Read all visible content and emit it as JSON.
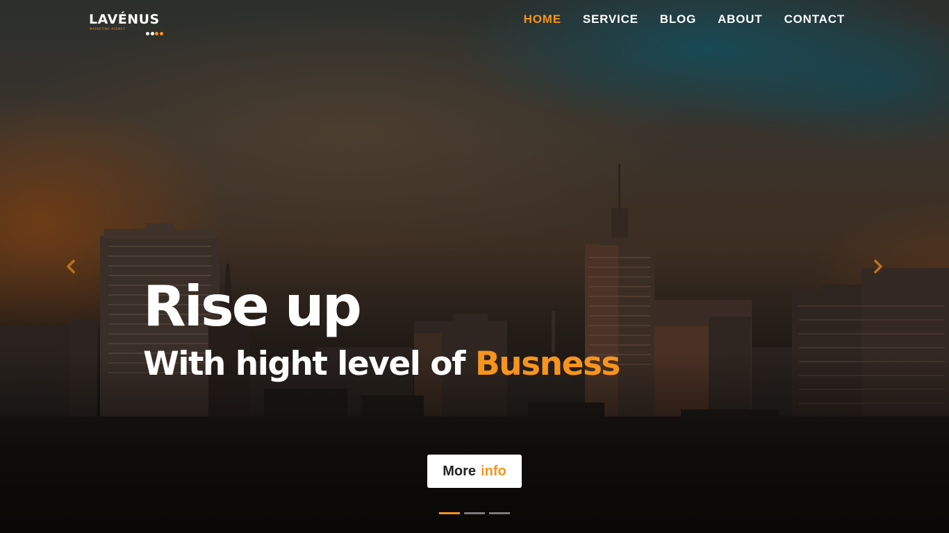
{
  "brand": {
    "name": "LAVÉNUS",
    "tagline": "MARKETING AGENCY",
    "accent_color": "#f7941d"
  },
  "nav": {
    "items": [
      {
        "label": "HOME",
        "active": true
      },
      {
        "label": "SERVICE",
        "active": false
      },
      {
        "label": "BLOG",
        "active": false
      },
      {
        "label": "ABOUT",
        "active": false
      },
      {
        "label": "CONTACT",
        "active": false
      }
    ]
  },
  "hero": {
    "headline": "Rise up",
    "subline_prefix": "With hight level of",
    "subline_highlight": "Busness",
    "cta": {
      "label_1": "More",
      "label_2": "info"
    },
    "prev_icon": "chevron-left-icon",
    "next_icon": "chevron-right-icon"
  },
  "carousel": {
    "slide_count": 3,
    "active_index": 0
  }
}
